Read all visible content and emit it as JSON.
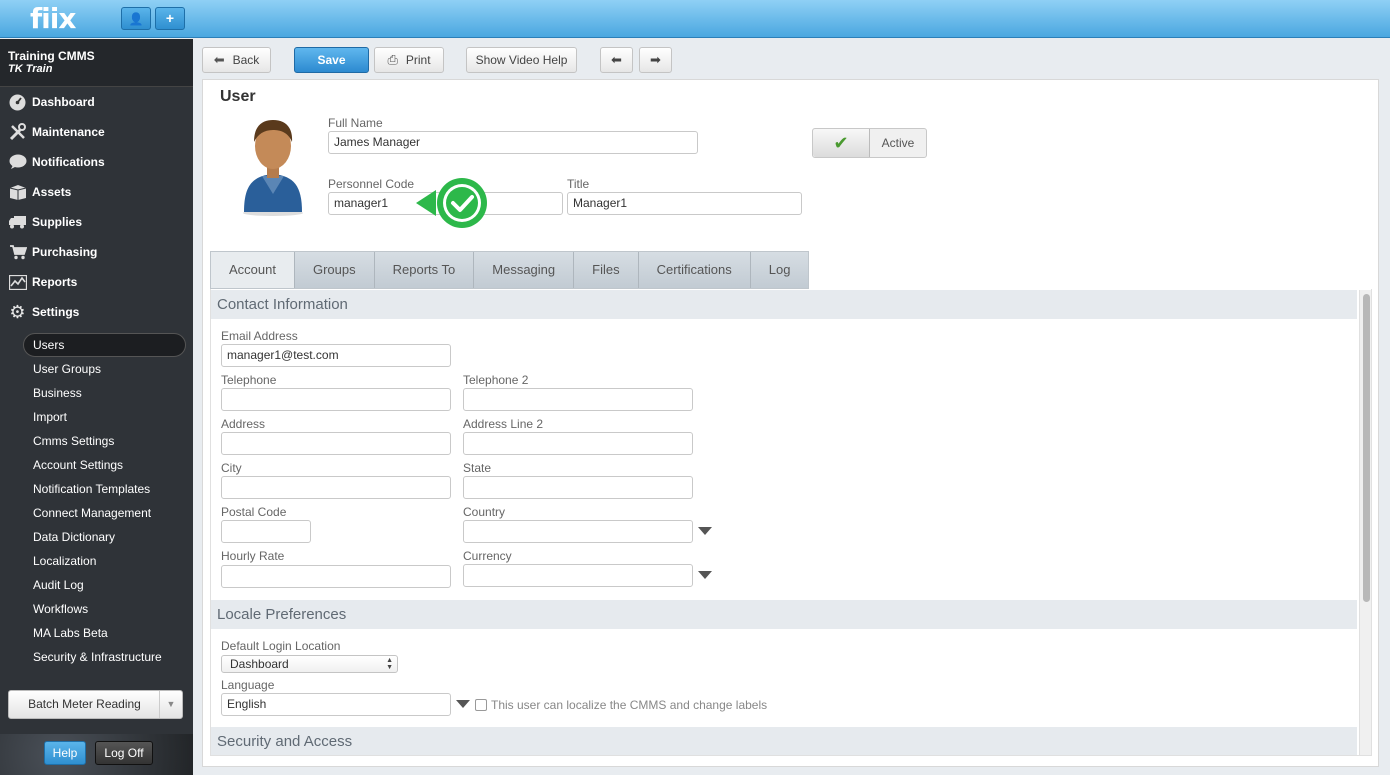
{
  "app": {
    "logo": "fiix",
    "top_buttons": [
      {
        "icon": "user-icon",
        "glyph": "👤"
      },
      {
        "icon": "plus-icon",
        "glyph": "+"
      }
    ]
  },
  "sidebar": {
    "org_name": "Training CMMS",
    "org_sub": "TK Train",
    "nav": [
      {
        "label": "Dashboard",
        "icon": "dashboard-icon"
      },
      {
        "label": "Maintenance",
        "icon": "wrench-icon"
      },
      {
        "label": "Notifications",
        "icon": "speech-bubble-icon"
      },
      {
        "label": "Assets",
        "icon": "box-icon"
      },
      {
        "label": "Supplies",
        "icon": "truck-icon"
      },
      {
        "label": "Purchasing",
        "icon": "cart-icon"
      },
      {
        "label": "Reports",
        "icon": "chart-icon"
      },
      {
        "label": "Settings",
        "icon": "gear-icon"
      }
    ],
    "settings_items": [
      "Users",
      "User Groups",
      "Business",
      "Import",
      "Cmms Settings",
      "Account Settings",
      "Notification Templates",
      "Connect Management",
      "Data Dictionary",
      "Localization",
      "Audit Log",
      "Workflows",
      "MA Labs Beta",
      "Security & Infrastructure"
    ],
    "batch_label": "Batch Meter Reading",
    "help_label": "Help",
    "logoff_label": "Log Off"
  },
  "toolbar": {
    "back": "Back",
    "save": "Save",
    "print": "Print",
    "video_help": "Show Video Help"
  },
  "user": {
    "heading": "User",
    "full_name_label": "Full Name",
    "full_name": "James Manager",
    "personnel_code_label": "Personnel Code",
    "personnel_code": "manager1",
    "title_label": "Title",
    "title": "Manager1",
    "active_label": "Active",
    "active": true
  },
  "tabs": [
    "Account",
    "Groups",
    "Reports To",
    "Messaging",
    "Files",
    "Certifications",
    "Log"
  ],
  "contact": {
    "heading": "Contact Information",
    "email_label": "Email Address",
    "email": "manager1@test.com",
    "telephone_label": "Telephone",
    "telephone": "",
    "telephone2_label": "Telephone 2",
    "telephone2": "",
    "address_label": "Address",
    "address": "",
    "address2_label": "Address Line 2",
    "address2": "",
    "city_label": "City",
    "city": "",
    "state_label": "State",
    "state": "",
    "postal_label": "Postal Code",
    "postal": "",
    "country_label": "Country",
    "country": "",
    "hourly_label": "Hourly Rate",
    "hourly": "",
    "currency_label": "Currency",
    "currency": ""
  },
  "locale": {
    "heading": "Locale Preferences",
    "login_location_label": "Default Login Location",
    "login_location": "Dashboard",
    "language_label": "Language",
    "language": "English",
    "localize_checkbox_label": "This user can localize the CMMS and change labels"
  },
  "security": {
    "heading": "Security and Access"
  },
  "colors": {
    "topbar": "#4aa7e0",
    "sidebar": "#2f3338",
    "save_button": "#2d8ad0",
    "marker_green": "#2db84a"
  }
}
